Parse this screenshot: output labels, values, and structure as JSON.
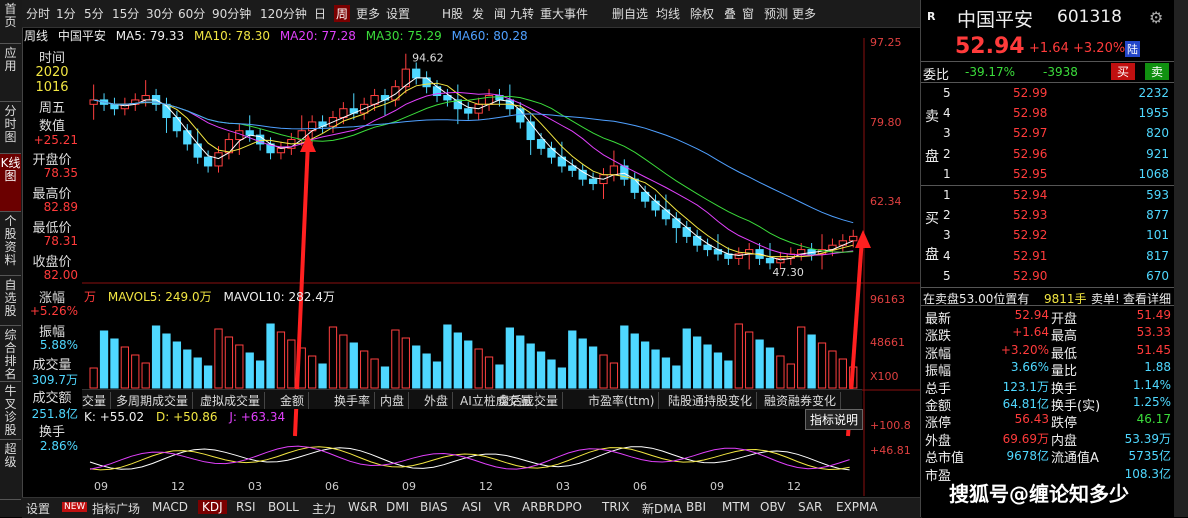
{
  "leftnav": [
    "首页",
    "应用",
    "分时图",
    "K线图",
    "个股资料",
    "自选股",
    "综合排名",
    "牛叉诊股",
    "超级"
  ],
  "toolbar": {
    "items": [
      "分时",
      "1分",
      "5分",
      "15分",
      "30分",
      "60分",
      "90分钟",
      "120分钟",
      "日",
      "周",
      "更多",
      "设置"
    ],
    "right_items": [
      "H股",
      "发",
      "闻",
      "九转",
      "重大事件",
      "删自选",
      "均线",
      "除权",
      "叠",
      "窗",
      "预测",
      "更多"
    ],
    "selected": "周"
  },
  "ma_legend": {
    "period": "周线",
    "name": "中国平安",
    "ma5": "MA5: 79.33",
    "ma10": "MA10: 78.30",
    "ma20": "MA20: 77.28",
    "ma30": "MA30: 75.29",
    "ma60": "MA60: 80.28"
  },
  "info": {
    "time_label": "时间",
    "time1": "2020",
    "time2": "1016",
    "weekday": "周五",
    "value_label": "数值",
    "value": "+25.21",
    "open_label": "开盘价",
    "open": "78.35",
    "high_label": "最高价",
    "high": "82.89",
    "low_label": "最低价",
    "low": "78.31",
    "close_label": "收盘价",
    "close": "82.00",
    "chg_label": "涨幅",
    "chg": "+5.26%",
    "amp_label": "振幅",
    "amp": "5.88%",
    "vol_label": "成交量",
    "vol": "309.7万",
    "amt_label": "成交额",
    "amt": "251.8亿",
    "turn_label": "换手",
    "turn": "2.86%"
  },
  "price_axis": [
    "97.25",
    "79.80",
    "62.34",
    "96163",
    "48661",
    "X100",
    "+100.8",
    "+46.81"
  ],
  "annotations": {
    "high": "94.62",
    "low": "47.30"
  },
  "volume_legend": {
    "unit": "万",
    "mavol5": "MAVOL5: 249.0万",
    "mavol10": "MAVOL10: 282.4万"
  },
  "indicator_tabs": [
    "交量",
    "多周期成交量",
    "虚拟成交量",
    "金额",
    "换手率",
    "内盘",
    "外盘",
    "AI立桩成交量",
    "盘后成交量",
    "市盈率(ttm)",
    "陆股通持股变化",
    "融资融券变化"
  ],
  "kdj_legend": {
    "k": "K: +55.02",
    "d": "D: +50.86",
    "j": "J: +63.34",
    "explain": "指标说明"
  },
  "x_ticks": [
    "09",
    "12",
    "03",
    "06",
    "09",
    "12",
    "03",
    "06",
    "09",
    "12"
  ],
  "bottom_tabs": [
    "设置",
    "NEW",
    "指标广场",
    "MACD",
    "KDJ",
    "RSI",
    "BOLL",
    "主力",
    "W&R",
    "DMI",
    "BIAS",
    "ASI",
    "VR",
    "ARBR",
    "DPO",
    "TRIX",
    "新DMA",
    "BBI",
    "MTM",
    "OBV",
    "SAR",
    "EXPMA"
  ],
  "bottom_selected": "KDJ",
  "right": {
    "r_label": "R",
    "stock_name": "中国平安",
    "code": "601318",
    "price": "52.94",
    "change": "+1.64",
    "pct": "+3.20%",
    "tag": "陆",
    "weibi_label": "委比",
    "weibi": "-39.17%",
    "weicha": "-3938",
    "buy_btn": "买",
    "sell_btn": "卖",
    "sell_label_1": "卖",
    "sell_label_2": "盘",
    "buy_label_1": "买",
    "buy_label_2": "盘",
    "asks": [
      [
        "5",
        "52.99",
        "2232"
      ],
      [
        "4",
        "52.98",
        "1955"
      ],
      [
        "3",
        "52.97",
        "820"
      ],
      [
        "2",
        "52.96",
        "921"
      ],
      [
        "1",
        "52.95",
        "1068"
      ]
    ],
    "bids": [
      [
        "1",
        "52.94",
        "593"
      ],
      [
        "2",
        "52.93",
        "877"
      ],
      [
        "3",
        "52.92",
        "101"
      ],
      [
        "4",
        "52.91",
        "817"
      ],
      [
        "5",
        "52.90",
        "670"
      ]
    ],
    "ticker_text": "在卖盘53.00位置有",
    "ticker_qty": "9811手",
    "ticker_tail": "卖单!",
    "detail": "查看详细",
    "stats": [
      [
        "最新",
        "52.94",
        "开盘",
        "51.49"
      ],
      [
        "涨跌",
        "+1.64",
        "最高",
        "53.33"
      ],
      [
        "涨幅",
        "+3.20%",
        "最低",
        "51.45"
      ],
      [
        "振幅",
        "3.66%",
        "量比",
        "1.88"
      ],
      [
        "总手",
        "123.1万",
        "换手",
        "1.14%"
      ],
      [
        "金额",
        "64.81亿",
        "换手(实)",
        "1.25%"
      ],
      [
        "涨停",
        "56.43",
        "跌停",
        "46.17"
      ],
      [
        "外盘",
        "69.69万",
        "内盘",
        "53.39万"
      ],
      [
        "总市值",
        "9678亿",
        "流通值A",
        "5735亿"
      ],
      [
        "市盈",
        "",
        "",
        "108.3亿"
      ]
    ],
    "watermark": "搜狐号@缠论知多少"
  },
  "colors": {
    "up": "#ff3b3b",
    "down": "#3bdc3b",
    "vol_up": "#4fd8ff",
    "ma5": "#ffffff",
    "ma10": "#f2e642",
    "ma20": "#e040fb",
    "ma30": "#3bdc3b",
    "ma60": "#4fa0ff",
    "arrow": "#ff2020"
  },
  "chart_data": {
    "type": "candlestick",
    "title": "中国平安 周线",
    "price_high": 94.62,
    "price_low": 47.3,
    "y_ticks": [
      97.25,
      79.8,
      62.34
    ],
    "closes": [
      85,
      84,
      83,
      84,
      85,
      86,
      84,
      81,
      78,
      75,
      72,
      70,
      73,
      76,
      78,
      77,
      75,
      73,
      74,
      76,
      78,
      80,
      79,
      81,
      83,
      82,
      84,
      86,
      85,
      88,
      92,
      90,
      88,
      86,
      85,
      83,
      82,
      84,
      86,
      85,
      83,
      80,
      76,
      74,
      72,
      70,
      69,
      67,
      66,
      68,
      70,
      67,
      64,
      62,
      60,
      58,
      56,
      54,
      52,
      51,
      50,
      49,
      50,
      51,
      49,
      48,
      49,
      50,
      51,
      50,
      51,
      52,
      53,
      54
    ]
  }
}
